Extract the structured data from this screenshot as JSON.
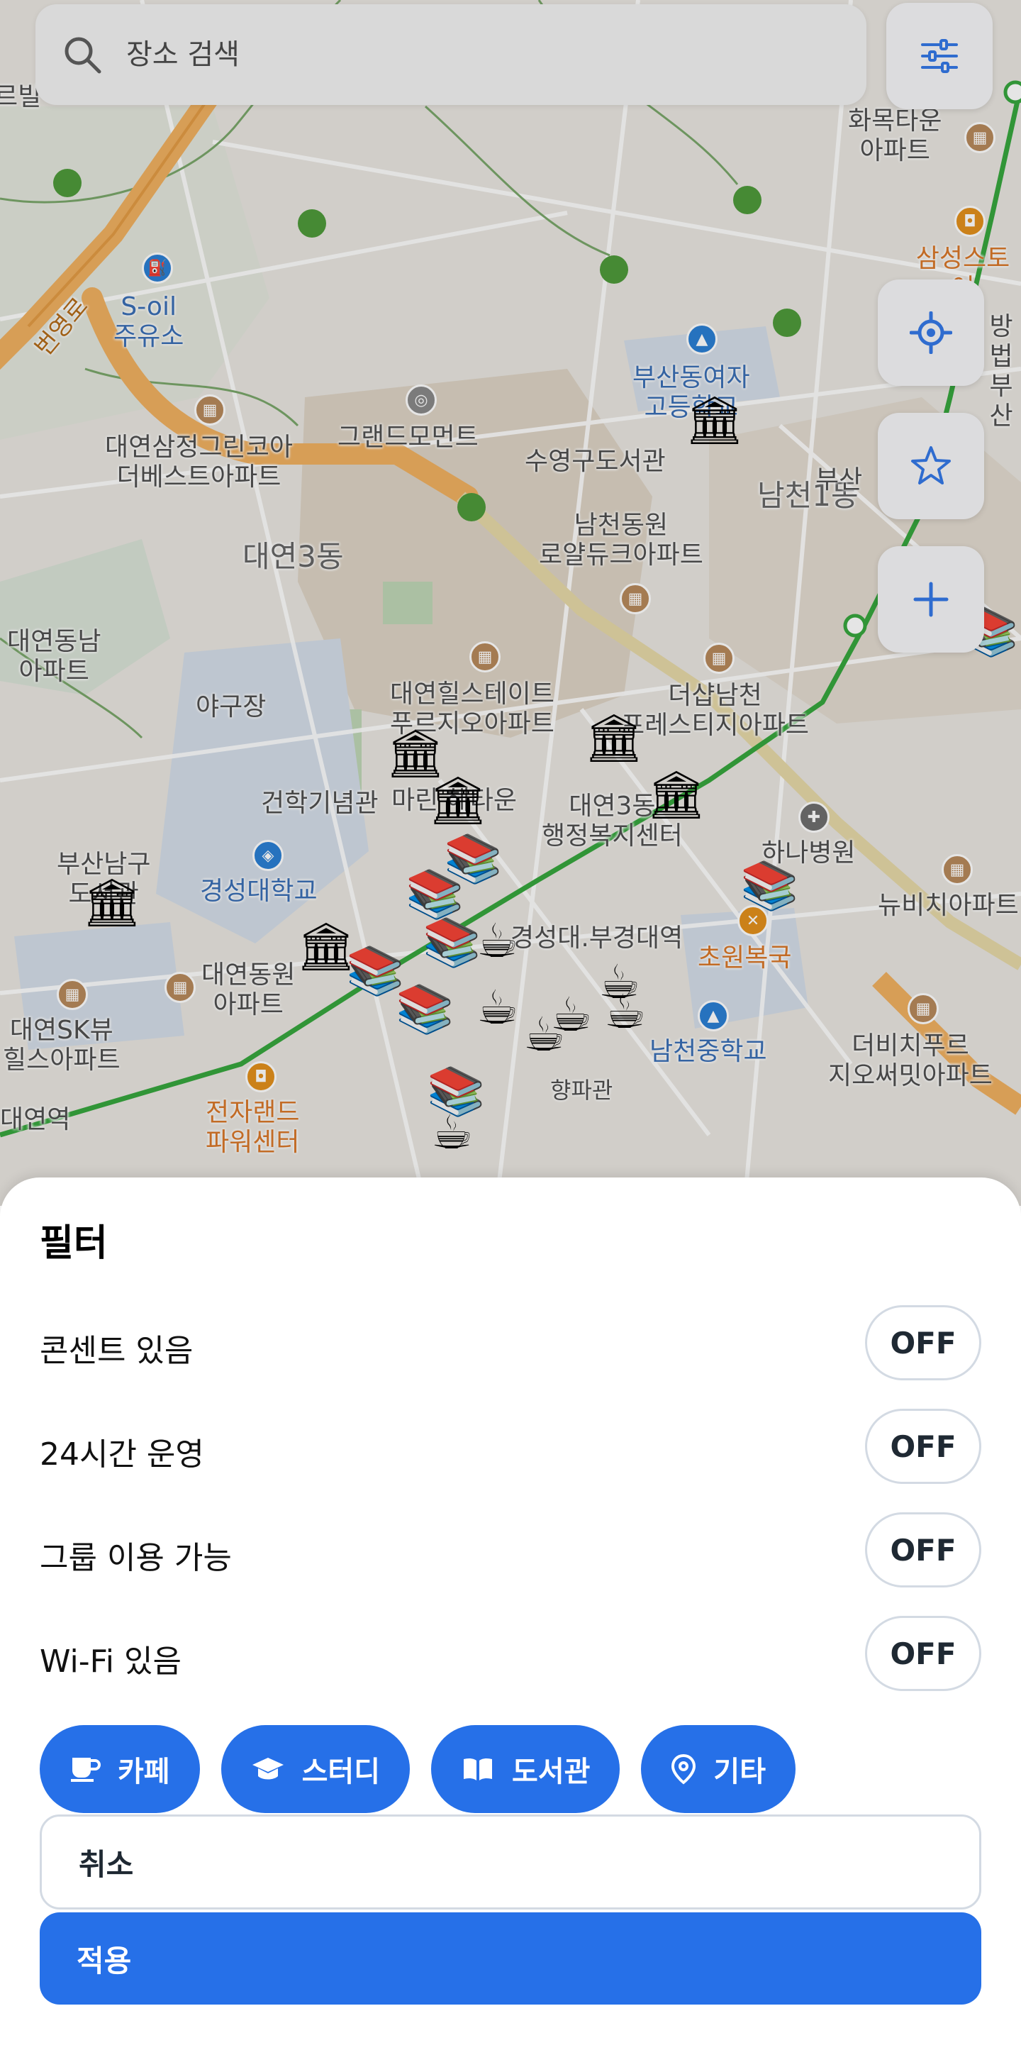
{
  "search": {
    "placeholder": "장소 검색"
  },
  "map": {
    "labels": {
      "fragment_left": "르빌",
      "hwamok": "화목타운\n아파트",
      "samsung": "삼성스토어",
      "s_oil": "S-oil\n주유소",
      "road": "번영로",
      "busan_girls": "부산동여자\n고등학교",
      "beob": "방법\n부산",
      "daeyeon_samjeong": "대연삼정그린코아\n더베스트아파트",
      "grand": "그랜드모먼트",
      "suyeong_lib": "수영구도서관",
      "namcheon1": "남천1동",
      "busan_frag": "부산",
      "daeyeon3": "대연3동",
      "namcheon_royal": "남천동원\n로얄듀크아파트",
      "daeyeon_dong_apt": "대연동남\n아파트",
      "yagu": "야구장",
      "hill_state": "대연힐스테이트\n푸르지오아파트",
      "the_sharp": "더샵남천\n프레스티지아파트",
      "geonhak": "건학기념관",
      "town": "마린 헤타운",
      "welfare": "대연3동\n행정복지센터",
      "hana": "하나병원",
      "nambu": "부산남구\n도서관",
      "kyungsung": "경성대학교",
      "newbiz": "뉴비치아파트",
      "pukyong": "경성대.부경대역",
      "chowon": "초원복국",
      "daeyeon_dongwon": "대연동원\n아파트",
      "sk_view": "대연SK뷰\n힐스아파트",
      "namcheon_middle": "남천중학교",
      "the_bichi": "더비치푸르\n지오써밋아파트",
      "hyangpa": "향파관",
      "daeyeon_station": "대연역",
      "electro": "전자랜드\n파워센터"
    }
  },
  "sheet": {
    "title": "필터",
    "filters": [
      {
        "label": "콘센트 있음",
        "state": "OFF"
      },
      {
        "label": "24시간 운영",
        "state": "OFF"
      },
      {
        "label": "그룹 이용 가능",
        "state": "OFF"
      },
      {
        "label": "Wi-Fi 있음",
        "state": "OFF"
      }
    ],
    "categories": [
      {
        "label": "카페",
        "icon": "coffee-cup-icon"
      },
      {
        "label": "스터디",
        "icon": "graduation-cap-icon"
      },
      {
        "label": "도서관",
        "icon": "open-book-icon"
      },
      {
        "label": "기타",
        "icon": "map-pin-icon"
      }
    ],
    "cancel_label": "취소",
    "apply_label": "적용"
  },
  "colors": {
    "accent": "#2670e8",
    "map_bg": "#e9e6e0",
    "road": "#f2b46a",
    "subway": "#37a63e"
  }
}
